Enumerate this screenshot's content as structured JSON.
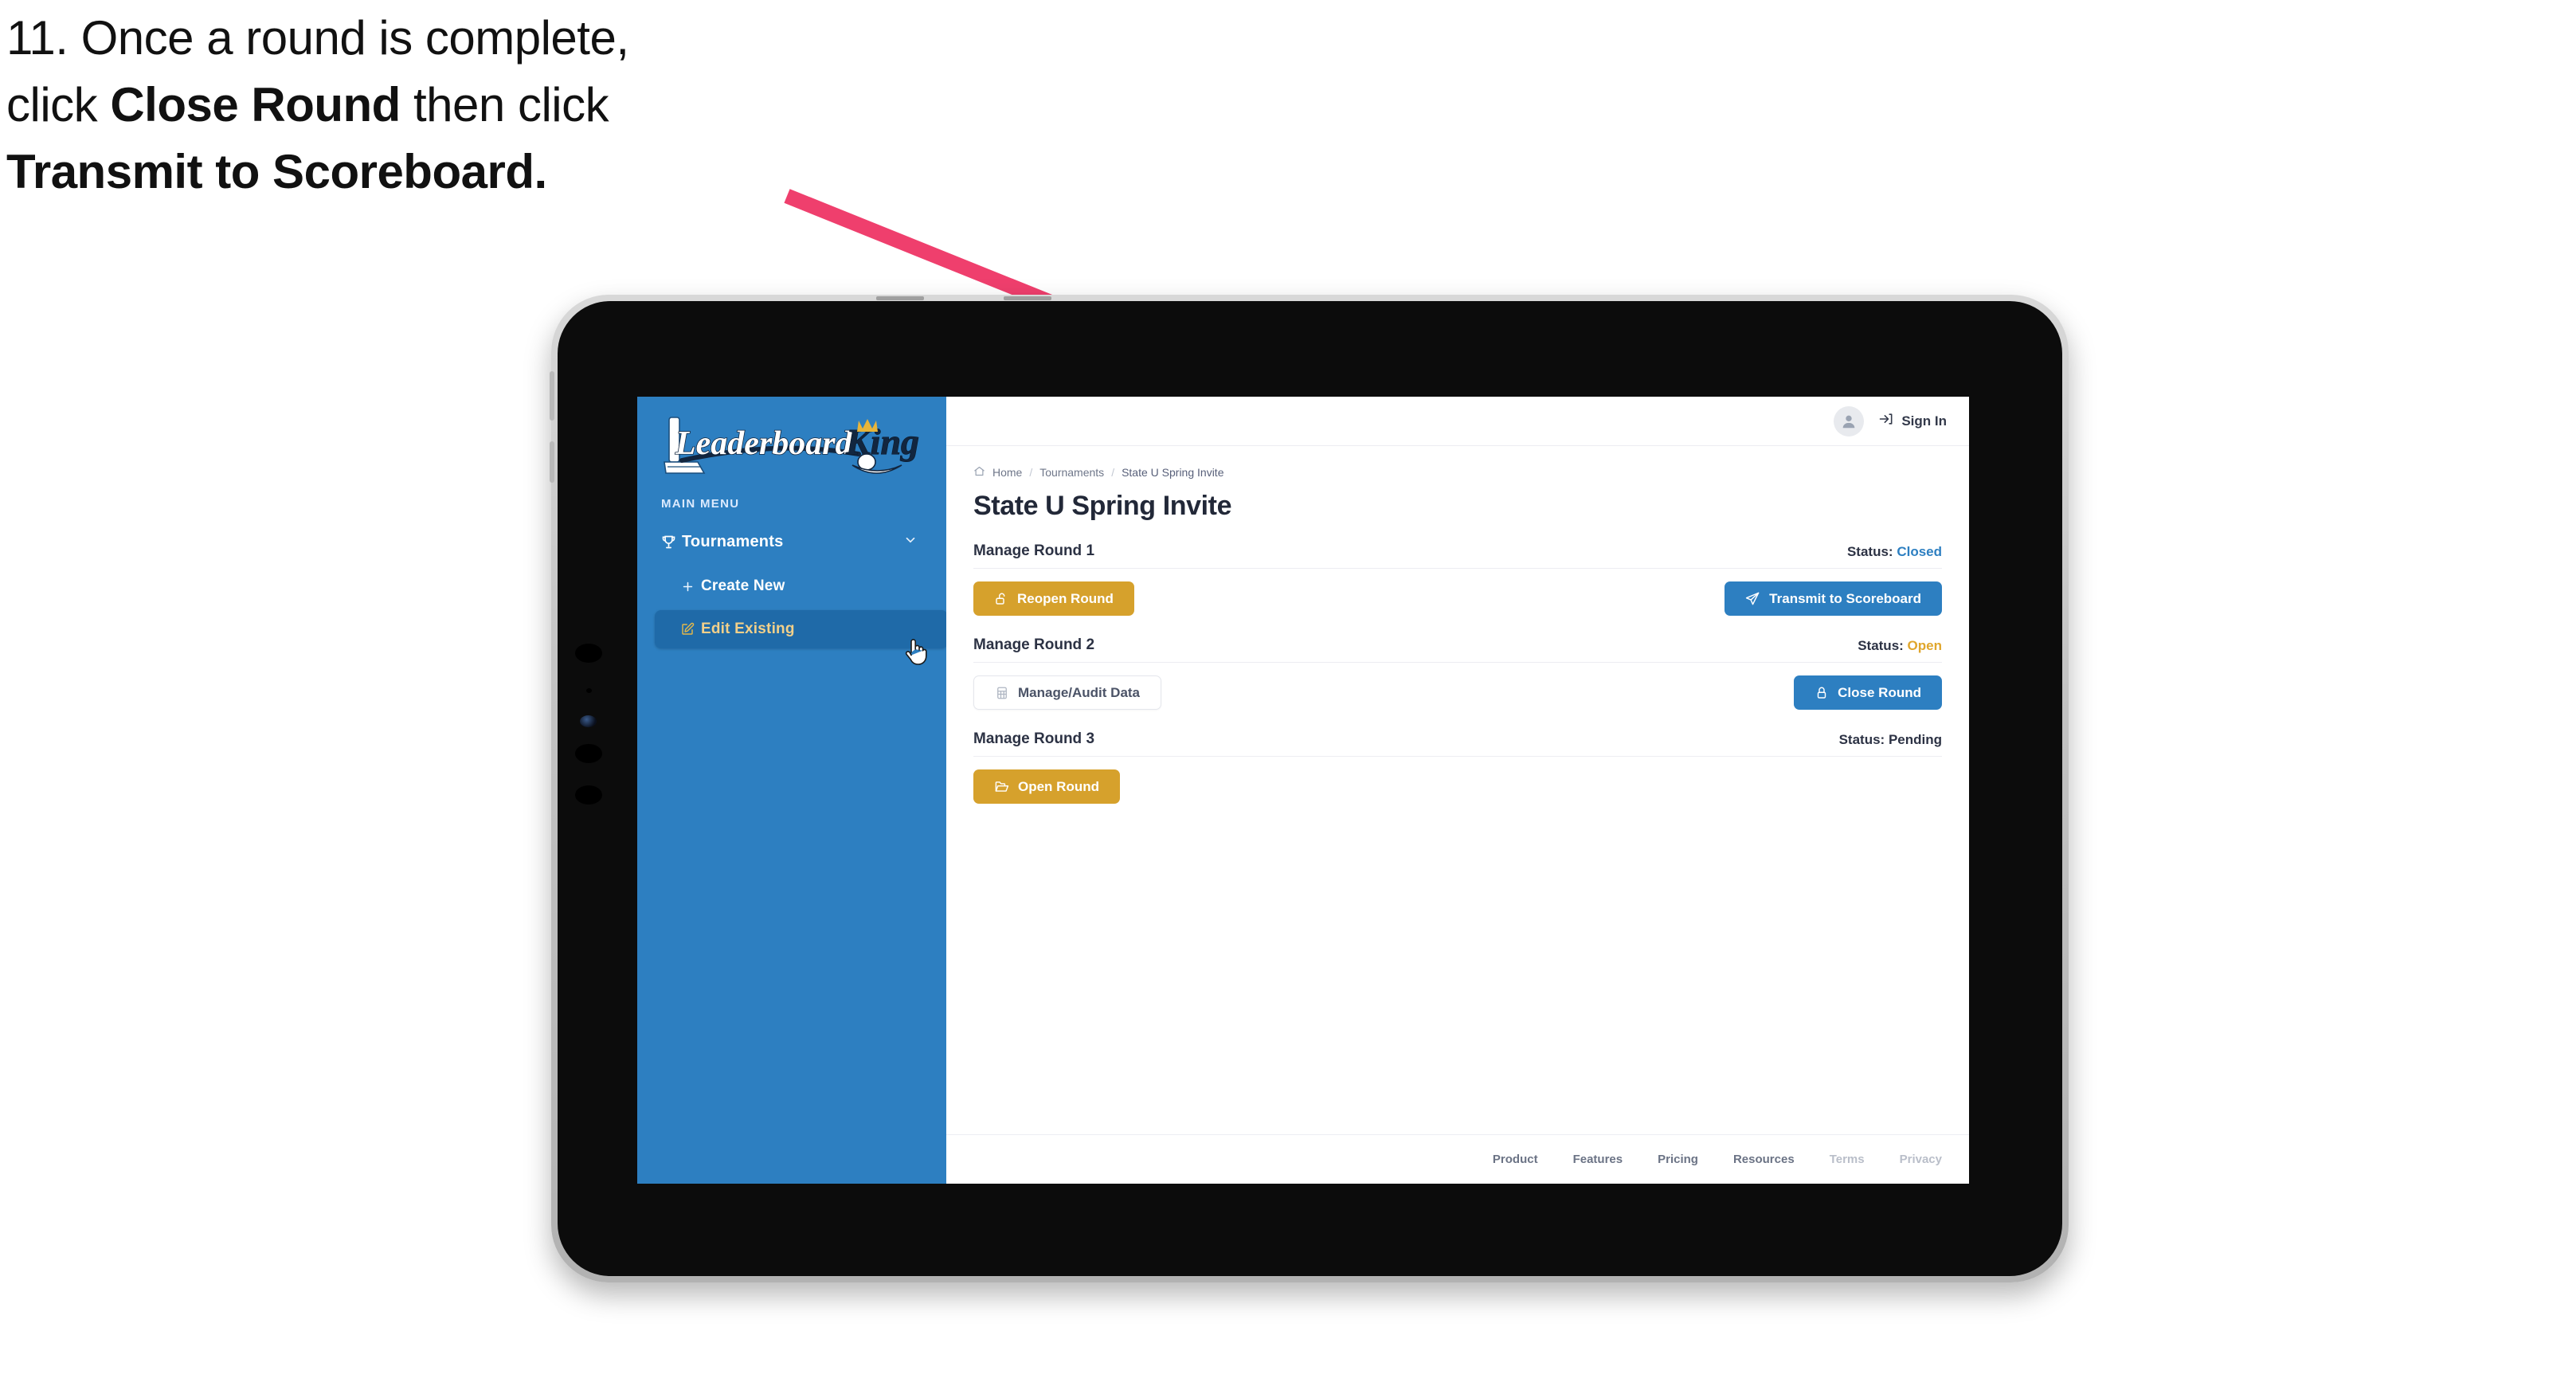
{
  "caption": {
    "line1_pre": "11. Once a round is complete,",
    "line2_pre": "click ",
    "line2_bold": "Close Round",
    "line2_post": " then click",
    "line3_bold": "Transmit to Scoreboard.",
    "arrow_color": "#ef3f6d"
  },
  "sidebar": {
    "brand_line1": "Leaderboard",
    "brand_line2": "King",
    "menu_label": "MAIN MENU",
    "items": [
      {
        "label": "Tournaments",
        "icon": "trophy-icon",
        "expand": "chevron-down-icon"
      },
      {
        "label": "Create New",
        "icon": "plus-icon"
      },
      {
        "label": "Edit Existing",
        "icon": "edit-pencil-icon"
      }
    ],
    "bg_color": "#2d7fc1",
    "active_bg_color": "#1f6aa8",
    "active_text_color": "#f2d08a"
  },
  "topbar": {
    "avatar_icon": "user-avatar-icon",
    "signin_icon": "sign-in-arrow-icon",
    "signin_label": "Sign In"
  },
  "breadcrumb": {
    "home_icon": "home-icon",
    "items": [
      "Home",
      "Tournaments",
      "State U Spring Invite"
    ],
    "separator": "/"
  },
  "page": {
    "title": "State U Spring Invite"
  },
  "rounds": [
    {
      "title": "Manage Round 1",
      "status_label": "Status:",
      "status_value": "Closed",
      "status_class": "status-closed",
      "left_button": {
        "label": "Reopen Round",
        "icon": "unlock-icon",
        "style": "btn-gold"
      },
      "right_button": {
        "label": "Transmit to Scoreboard",
        "icon": "paper-plane-icon",
        "style": "btn-blue"
      }
    },
    {
      "title": "Manage Round 2",
      "status_label": "Status:",
      "status_value": "Open",
      "status_class": "status-open",
      "left_button": {
        "label": "Manage/Audit Data",
        "icon": "table-grid-icon",
        "style": "btn-ghost"
      },
      "right_button": {
        "label": "Close Round",
        "icon": "lock-icon",
        "style": "btn-blue"
      }
    },
    {
      "title": "Manage Round 3",
      "status_label": "Status:",
      "status_value": "Pending",
      "status_class": "status-pending",
      "left_button": {
        "label": "Open Round",
        "icon": "open-folder-icon",
        "style": "btn-gold"
      },
      "right_button": null
    }
  ],
  "footer": {
    "links": [
      {
        "label": "Product",
        "muted": false
      },
      {
        "label": "Features",
        "muted": false
      },
      {
        "label": "Pricing",
        "muted": false
      },
      {
        "label": "Resources",
        "muted": false
      },
      {
        "label": "Terms",
        "muted": true
      },
      {
        "label": "Privacy",
        "muted": true
      }
    ]
  },
  "cursor": {
    "type": "pointing-hand-cursor"
  }
}
